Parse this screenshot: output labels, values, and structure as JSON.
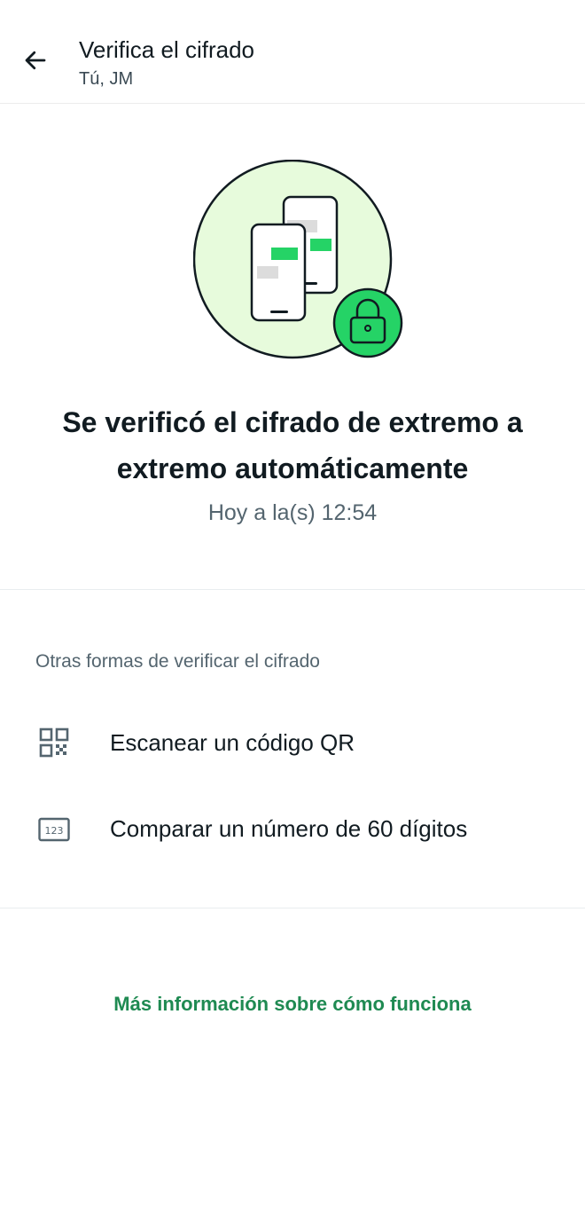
{
  "header": {
    "title": "Verifica el cifrado",
    "subtitle": "Tú, JM",
    "back_icon": "arrow-left-icon"
  },
  "hero": {
    "illustration": "phones-lock-illustration",
    "colors": {
      "circle_bg": "#e7fbdc",
      "accent": "#25d366",
      "outline": "#111b21"
    }
  },
  "status": {
    "headline": "Se verificó el cifrado de extremo a extremo automáticamente",
    "timestamp": "Hoy a la(s) 12:54"
  },
  "other_methods": {
    "label": "Otras formas de verificar el cifrado",
    "options": [
      {
        "label": "Escanear un código QR",
        "icon": "qr-code-icon"
      },
      {
        "label": "Comparar un número de 60 dígitos",
        "icon": "number-123-icon"
      }
    ]
  },
  "footer": {
    "link_label": "Más información sobre cómo funciona",
    "link_color": "#1f8a52"
  }
}
